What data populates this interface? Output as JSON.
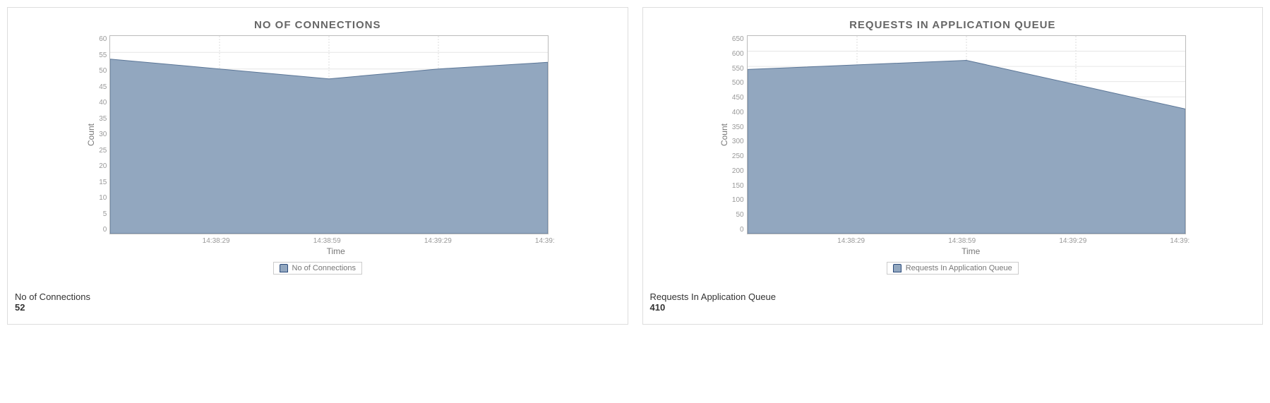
{
  "chart_data": [
    {
      "type": "area",
      "title": "NO OF CONNECTIONS",
      "xlabel": "Time",
      "ylabel": "Count",
      "ylim": [
        0,
        60
      ],
      "yticks": [
        0,
        5,
        10,
        15,
        20,
        25,
        30,
        35,
        40,
        45,
        50,
        55,
        60
      ],
      "xticks": [
        "14:38:29",
        "14:38:59",
        "14:39:29",
        "14:39:"
      ],
      "series": [
        {
          "name": "No of Connections",
          "x": [
            "14:37:59",
            "14:38:29",
            "14:38:59",
            "14:39:29",
            "14:39:59"
          ],
          "values": [
            53,
            50,
            47,
            50,
            52
          ]
        }
      ],
      "legend": "No of Connections"
    },
    {
      "type": "area",
      "title": "REQUESTS IN APPLICATION QUEUE",
      "xlabel": "Time",
      "ylabel": "Count",
      "ylim": [
        0,
        650
      ],
      "yticks": [
        0,
        50,
        100,
        150,
        200,
        250,
        300,
        350,
        400,
        450,
        500,
        550,
        600,
        650
      ],
      "xticks": [
        "14:38:29",
        "14:38:59",
        "14:39:29",
        "14:39:"
      ],
      "series": [
        {
          "name": "Requests In Application Queue",
          "x": [
            "14:37:59",
            "14:38:29",
            "14:38:59",
            "14:39:29",
            "14:39:59"
          ],
          "values": [
            540,
            555,
            570,
            490,
            410
          ]
        }
      ],
      "legend": "Requests In Application Queue"
    }
  ],
  "panels": [
    {
      "title": "NO OF CONNECTIONS",
      "ylabel": "Count",
      "xlabel": "Time",
      "legend": "No of Connections",
      "stat_label": "No of Connections",
      "stat_value": "52",
      "yticks": [
        "60",
        "55",
        "50",
        "45",
        "40",
        "35",
        "30",
        "25",
        "20",
        "15",
        "10",
        "5",
        "0"
      ],
      "xticks": [
        "14:38:29",
        "14:38:59",
        "14:39:29",
        "14:39:"
      ]
    },
    {
      "title": "REQUESTS IN APPLICATION QUEUE",
      "ylabel": "Count",
      "xlabel": "Time",
      "legend": "Requests In Application Queue",
      "stat_label": "Requests In Application Queue",
      "stat_value": "410",
      "yticks": [
        "650",
        "600",
        "550",
        "500",
        "450",
        "400",
        "350",
        "300",
        "250",
        "200",
        "150",
        "100",
        "50",
        "0"
      ],
      "xticks": [
        "14:38:29",
        "14:38:59",
        "14:39:29",
        "14:39:"
      ]
    }
  ]
}
